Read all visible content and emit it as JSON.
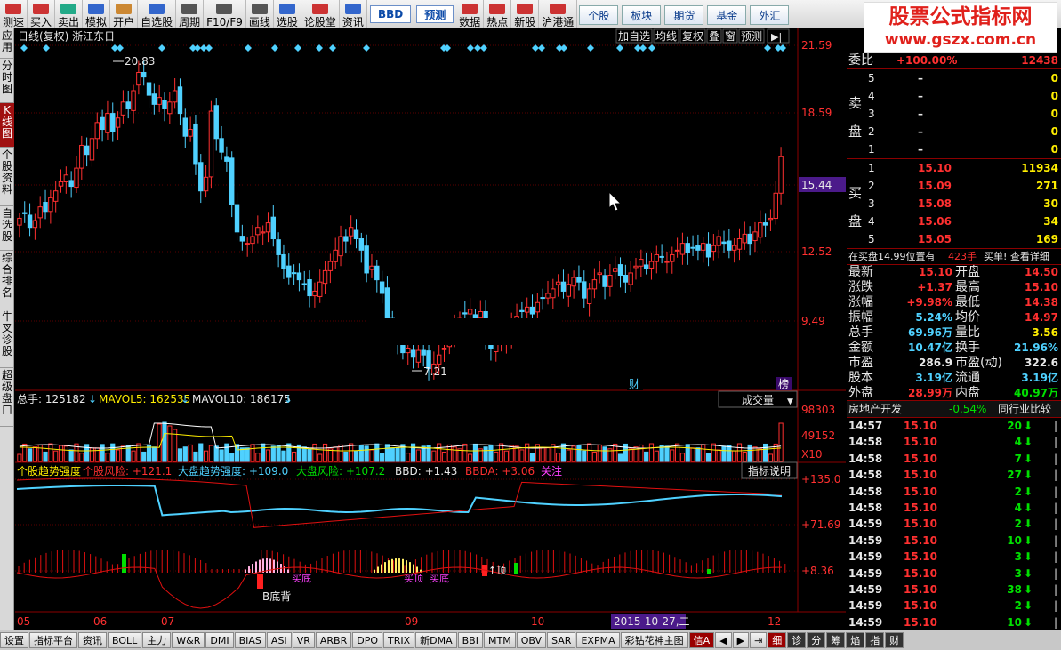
{
  "toolbar": {
    "buttons": [
      "测速",
      "买入",
      "卖出",
      "模拟",
      "开户",
      "自选股",
      "周期",
      "F10/F9",
      "画线",
      "选股",
      "论股堂",
      "资讯"
    ],
    "boxes": [
      "BBD",
      "预测"
    ],
    "buttons2": [
      "数据",
      "热点",
      "新股",
      "沪港通"
    ],
    "tabs": [
      "个股",
      "板块",
      "期货",
      "基金",
      "外汇"
    ]
  },
  "logo": {
    "line1": "股票公式指标网",
    "line2": "www.gszx.com.cn"
  },
  "sidebar": [
    "应用",
    "分时图",
    "K线图",
    "个股资料",
    "自选股",
    "综合排名",
    "牛叉诊股",
    "超级盘口"
  ],
  "main": {
    "title": "日线(复权) 浙江东日",
    "buttons": [
      "加自选",
      "均线",
      "复权",
      "叠",
      "窗",
      "预测"
    ],
    "price_ticks": [
      "21.59",
      "18.59",
      "15.44",
      "12.52",
      "9.49"
    ],
    "high_label": "20.83",
    "low_label": "7.21",
    "marker_cai": "财",
    "marker_bang": "榜"
  },
  "volume": {
    "label_total": "总手: 125182",
    "label_ma5": "MAVOL5: 162535",
    "label_ma10": "MAVOL10: 186175",
    "dropdown": "成交量",
    "ticks": [
      "98303",
      "49152",
      "X10"
    ]
  },
  "indicator": {
    "labels": [
      "个股趋势强度",
      "个股风险: +121.1",
      "大盘趋势强度: +109.0",
      "大盘风险: +107.2",
      "BBD: +1.43",
      "BBDA: +3.06",
      "关注"
    ],
    "button": "指标说明",
    "ticks": [
      "+135.0",
      "+71.69",
      "+8.36"
    ],
    "annotations": [
      "买底",
      "买顶",
      "买底",
      "↑顶",
      "B底背"
    ]
  },
  "xaxis": {
    "labels": [
      "05",
      "06",
      "07",
      "09",
      "10",
      "12"
    ],
    "cursor_date": "2015-10-27,二"
  },
  "panel": {
    "weibi": {
      "label": "委比",
      "pct": "+100.00%",
      "value": "12438"
    },
    "sell_label": "卖盘",
    "buy_label": "买盘",
    "sell": [
      [
        "5",
        "–",
        "0"
      ],
      [
        "4",
        "–",
        "0"
      ],
      [
        "3",
        "–",
        "0"
      ],
      [
        "2",
        "–",
        "0"
      ],
      [
        "1",
        "–",
        "0"
      ]
    ],
    "buy": [
      [
        "1",
        "15.10",
        "11934"
      ],
      [
        "2",
        "15.09",
        "271"
      ],
      [
        "3",
        "15.08",
        "30"
      ],
      [
        "4",
        "15.06",
        "34"
      ],
      [
        "5",
        "15.05",
        "169"
      ]
    ],
    "notice": {
      "text": "在买盘14.99位置有",
      "qty": "423手",
      "action": "买单! 查看详细"
    },
    "stats": [
      [
        "最新",
        "15.10",
        "开盘",
        "14.50"
      ],
      [
        "涨跌",
        "+1.37",
        "最高",
        "15.10"
      ],
      [
        "涨幅",
        "+9.98%",
        "最低",
        "14.38"
      ],
      [
        "振幅",
        "5.24%",
        "均价",
        "14.97"
      ],
      [
        "总手",
        "69.96万",
        "量比",
        "3.56"
      ],
      [
        "金额",
        "10.47亿",
        "换手",
        "21.96%"
      ],
      [
        "市盈",
        "286.9",
        "市盈(动)",
        "322.6"
      ],
      [
        "股本",
        "3.19亿",
        "流通",
        "3.19亿"
      ],
      [
        "外盘",
        "28.99万",
        "内盘",
        "40.97万"
      ]
    ],
    "sector": {
      "name": "房地产开发",
      "pct": "-0.54%",
      "compare": "同行业比较"
    },
    "ticks": [
      [
        "14:57",
        "15.10",
        "20"
      ],
      [
        "14:58",
        "15.10",
        "4"
      ],
      [
        "14:58",
        "15.10",
        "7"
      ],
      [
        "14:58",
        "15.10",
        "27"
      ],
      [
        "14:58",
        "15.10",
        "2"
      ],
      [
        "14:58",
        "15.10",
        "4"
      ],
      [
        "14:59",
        "15.10",
        "2"
      ],
      [
        "14:59",
        "15.10",
        "10"
      ],
      [
        "14:59",
        "15.10",
        "3"
      ],
      [
        "14:59",
        "15.10",
        "3"
      ],
      [
        "14:59",
        "15.10",
        "38"
      ],
      [
        "14:59",
        "15.10",
        "2"
      ],
      [
        "14:59",
        "15.10",
        "10"
      ]
    ]
  },
  "bottom": {
    "tabs": [
      "设置",
      "指标平台",
      "资讯",
      "BOLL",
      "主力",
      "W&R",
      "DMI",
      "BIAS",
      "ASI",
      "VR",
      "ARBR",
      "DPO",
      "TRIX",
      "新DMA",
      "BBI",
      "MTM",
      "OBV",
      "SAR",
      "EXPMA",
      "彩钻花神主图",
      "信A"
    ],
    "right_tabs": [
      "细",
      "诊",
      "分",
      "筹",
      "焰",
      "指",
      "财"
    ]
  },
  "colors": {
    "up": "#ff3030",
    "down": "#4fd1ff",
    "ma5": "#ffffff",
    "ma10": "#ffee00",
    "grid": "#8b0000",
    "accent": "#9a0000"
  }
}
